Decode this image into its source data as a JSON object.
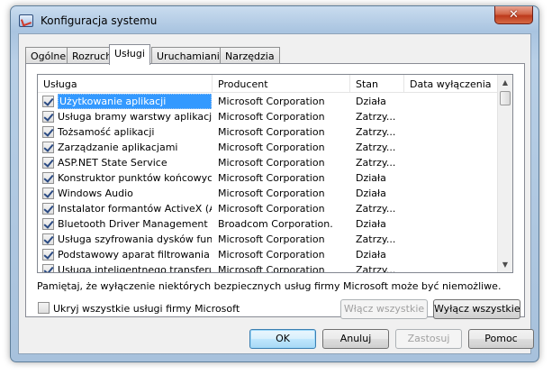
{
  "window": {
    "title": "Konfiguracja systemu",
    "close_label": "✕"
  },
  "tabs": [
    {
      "label": "Ogólne"
    },
    {
      "label": "Rozruch"
    },
    {
      "label": "Usługi"
    },
    {
      "label": "Uruchamianie"
    },
    {
      "label": "Narzędzia"
    }
  ],
  "active_tab": "Usługi",
  "services": {
    "columns": [
      "Usługa",
      "Producent",
      "Stan",
      "Data wyłączenia"
    ],
    "rows": [
      {
        "checked": true,
        "name": "Użytkowanie aplikacji",
        "vendor": "Microsoft Corporation",
        "status": "Działa",
        "disabled_date": ""
      },
      {
        "checked": true,
        "name": "Usługa bramy warstwy aplikacji",
        "vendor": "Microsoft Corporation",
        "status": "Zatrzy...",
        "disabled_date": ""
      },
      {
        "checked": true,
        "name": "Tożsamość aplikacji",
        "vendor": "Microsoft Corporation",
        "status": "Zatrzy...",
        "disabled_date": ""
      },
      {
        "checked": true,
        "name": "Zarządzanie aplikacjami",
        "vendor": "Microsoft Corporation",
        "status": "Zatrzy...",
        "disabled_date": ""
      },
      {
        "checked": true,
        "name": "ASP.NET State Service",
        "vendor": "Microsoft Corporation",
        "status": "Zatrzy...",
        "disabled_date": ""
      },
      {
        "checked": true,
        "name": "Konstruktor punktów końcowych...",
        "vendor": "Microsoft Corporation",
        "status": "Działa",
        "disabled_date": ""
      },
      {
        "checked": true,
        "name": "Windows Audio",
        "vendor": "Microsoft Corporation",
        "status": "Działa",
        "disabled_date": ""
      },
      {
        "checked": true,
        "name": "Instalator formantów ActiveX (A...",
        "vendor": "Microsoft Corporation",
        "status": "Zatrzy...",
        "disabled_date": ""
      },
      {
        "checked": true,
        "name": "Bluetooth Driver Management S...",
        "vendor": "Broadcom Corporation.",
        "status": "Działa",
        "disabled_date": ""
      },
      {
        "checked": true,
        "name": "Usługa szyfrowania dysków fun...",
        "vendor": "Microsoft Corporation",
        "status": "Zatrzy...",
        "disabled_date": ""
      },
      {
        "checked": true,
        "name": "Podstawowy aparat filtrowania",
        "vendor": "Microsoft Corporation",
        "status": "Działa",
        "disabled_date": ""
      },
      {
        "checked": true,
        "name": "Usługa inteligentnego transferu ...",
        "vendor": "Microsoft Corporation",
        "status": "Zatrzy...",
        "disabled_date": ""
      }
    ],
    "selected_index": 0
  },
  "notice": "Pamiętaj, że wyłączenie niektórych bezpiecznych usług firmy Microsoft może być niemożliwe.",
  "hide_ms": {
    "label": "Ukryj wszystkie usługi firmy Microsoft",
    "checked": false
  },
  "buttons": {
    "enable_all": "Włącz wszystkie",
    "disable_all": "Wyłącz wszystkie",
    "ok": "OK",
    "cancel": "Anuluj",
    "apply": "Zastosuj",
    "help": "Pomoc"
  },
  "colors": {
    "selection": "#3399ff",
    "close_button": "#c84a2b"
  }
}
